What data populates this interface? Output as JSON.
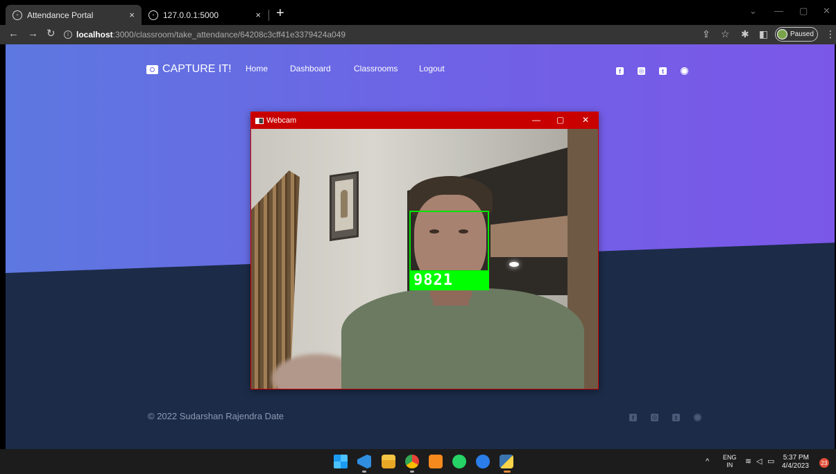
{
  "browser": {
    "tabs": [
      {
        "title": "Attendance Portal",
        "close": "×"
      },
      {
        "title": "127.0.0.1:5000",
        "close": "×"
      }
    ],
    "new_tab": "+",
    "window_controls": {
      "dropdown": "⌄",
      "minimize": "—",
      "restore": "▢",
      "close": "✕"
    },
    "url_host": "localhost",
    "url_rest": ":3000/classroom/take_attendance/64208c3cff41e3379424a049",
    "profile_status": "Paused"
  },
  "site": {
    "brand": "CAPTURE IT!",
    "nav": [
      "Home",
      "Dashboard",
      "Classrooms",
      "Logout"
    ],
    "social_icons": [
      "facebook-icon",
      "instagram-icon",
      "twitter-icon",
      "github-icon"
    ],
    "copyright": "© 2022 Sudarshan Rajendra Date"
  },
  "webcam": {
    "title": "Webcam",
    "face_id": "9821",
    "box_color": "#00e600"
  },
  "taskbar": {
    "apps": [
      "windows-start-icon",
      "vscode-icon",
      "file-explorer-icon",
      "chrome-icon",
      "sublime-text-icon",
      "whatsapp-icon",
      "app-icon",
      "python-icon"
    ],
    "language_top": "ENG",
    "language_bottom": "IN",
    "time": "5:37 PM",
    "date": "4/4/2023",
    "notifications": "23"
  },
  "colors": {
    "gradient_start": "#5d78e0",
    "gradient_end": "#7b57e8",
    "footer": "#1c2b48",
    "webcam_titlebar": "#c80000"
  }
}
